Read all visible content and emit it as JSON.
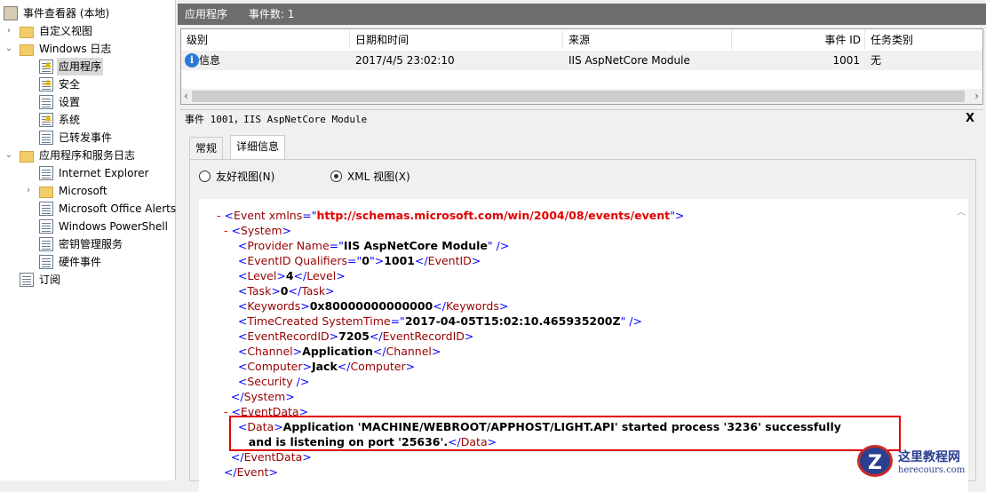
{
  "tree": [
    {
      "label": "事件查看器 (本地)",
      "icon": "root",
      "exp": ""
    },
    {
      "label": "自定义视图",
      "icon": "folder",
      "exp": ">"
    },
    {
      "label": "Windows 日志",
      "icon": "folder",
      "exp": "v"
    },
    {
      "label": "应用程序",
      "icon": "log-warn",
      "exp": "",
      "selected": true
    },
    {
      "label": "安全",
      "icon": "log-warn",
      "exp": ""
    },
    {
      "label": "设置",
      "icon": "log",
      "exp": ""
    },
    {
      "label": "系统",
      "icon": "log-warn",
      "exp": ""
    },
    {
      "label": "已转发事件",
      "icon": "log",
      "exp": ""
    },
    {
      "label": "应用程序和服务日志",
      "icon": "folder",
      "exp": "v"
    },
    {
      "label": "Internet Explorer",
      "icon": "log",
      "exp": ""
    },
    {
      "label": "Microsoft",
      "icon": "folder",
      "exp": ">"
    },
    {
      "label": "Microsoft Office Alerts",
      "icon": "log",
      "exp": ""
    },
    {
      "label": "Windows PowerShell",
      "icon": "log",
      "exp": ""
    },
    {
      "label": "密钥管理服务",
      "icon": "log",
      "exp": ""
    },
    {
      "label": "硬件事件",
      "icon": "log",
      "exp": ""
    },
    {
      "label": "订阅",
      "icon": "log",
      "exp": ""
    }
  ],
  "header": {
    "title": "应用程序",
    "count": "事件数: 1"
  },
  "grid": {
    "columns": [
      "级别",
      "日期和时间",
      "来源",
      "事件 ID",
      "任务类别"
    ],
    "row": {
      "level": "信息",
      "date": "2017/4/5 23:02:10",
      "source": "IIS AspNetCore Module",
      "id": "1001",
      "task": "无"
    }
  },
  "detail": {
    "title": "事件 1001，IIS AspNetCore Module",
    "close": "X",
    "tabs": [
      "常规",
      "详细信息"
    ],
    "radio_friendly": "友好视图(N)",
    "radio_xml": "XML 视图(X)"
  },
  "xml": [
    [
      [
        "m",
        "- "
      ],
      [
        "b",
        "<"
      ],
      [
        "n",
        "Event xmlns"
      ],
      [
        "b",
        "=\""
      ],
      [
        "v",
        "http://schemas.microsoft.com/win/2004/08/events/event"
      ],
      [
        "b",
        "\">"
      ]
    ],
    [
      [
        "m",
        "  - "
      ],
      [
        "b",
        "<"
      ],
      [
        "n",
        "System"
      ],
      [
        "b",
        ">"
      ]
    ],
    [
      [
        "",
        "      "
      ],
      [
        "b",
        "<"
      ],
      [
        "n",
        "Provider Name"
      ],
      [
        "b",
        "=\""
      ],
      [
        "t",
        "IIS AspNetCore Module"
      ],
      [
        "b",
        "\" />"
      ]
    ],
    [
      [
        "",
        "      "
      ],
      [
        "b",
        "<"
      ],
      [
        "n",
        "EventID Qualifiers"
      ],
      [
        "b",
        "=\""
      ],
      [
        "t",
        "0"
      ],
      [
        "b",
        "\">"
      ],
      [
        "t",
        "1001"
      ],
      [
        "b",
        "</"
      ],
      [
        "n",
        "EventID"
      ],
      [
        "b",
        ">"
      ]
    ],
    [
      [
        "",
        "      "
      ],
      [
        "b",
        "<"
      ],
      [
        "n",
        "Level"
      ],
      [
        "b",
        ">"
      ],
      [
        "t",
        "4"
      ],
      [
        "b",
        "</"
      ],
      [
        "n",
        "Level"
      ],
      [
        "b",
        ">"
      ]
    ],
    [
      [
        "",
        "      "
      ],
      [
        "b",
        "<"
      ],
      [
        "n",
        "Task"
      ],
      [
        "b",
        ">"
      ],
      [
        "t",
        "0"
      ],
      [
        "b",
        "</"
      ],
      [
        "n",
        "Task"
      ],
      [
        "b",
        ">"
      ]
    ],
    [
      [
        "",
        "      "
      ],
      [
        "b",
        "<"
      ],
      [
        "n",
        "Keywords"
      ],
      [
        "b",
        ">"
      ],
      [
        "t",
        "0x80000000000000"
      ],
      [
        "b",
        "</"
      ],
      [
        "n",
        "Keywords"
      ],
      [
        "b",
        ">"
      ]
    ],
    [
      [
        "",
        "      "
      ],
      [
        "b",
        "<"
      ],
      [
        "n",
        "TimeCreated SystemTime"
      ],
      [
        "b",
        "=\""
      ],
      [
        "t",
        "2017-04-05T15:02:10.465935200Z"
      ],
      [
        "b",
        "\" />"
      ]
    ],
    [
      [
        "",
        "      "
      ],
      [
        "b",
        "<"
      ],
      [
        "n",
        "EventRecordID"
      ],
      [
        "b",
        ">"
      ],
      [
        "t",
        "7205"
      ],
      [
        "b",
        "</"
      ],
      [
        "n",
        "EventRecordID"
      ],
      [
        "b",
        ">"
      ]
    ],
    [
      [
        "",
        "      "
      ],
      [
        "b",
        "<"
      ],
      [
        "n",
        "Channel"
      ],
      [
        "b",
        ">"
      ],
      [
        "t",
        "Application"
      ],
      [
        "b",
        "</"
      ],
      [
        "n",
        "Channel"
      ],
      [
        "b",
        ">"
      ]
    ],
    [
      [
        "",
        "      "
      ],
      [
        "b",
        "<"
      ],
      [
        "n",
        "Computer"
      ],
      [
        "b",
        ">"
      ],
      [
        "t",
        "Jack"
      ],
      [
        "b",
        "</"
      ],
      [
        "n",
        "Computer"
      ],
      [
        "b",
        ">"
      ]
    ],
    [
      [
        "",
        "      "
      ],
      [
        "b",
        "<"
      ],
      [
        "n",
        "Security"
      ],
      [
        "b",
        " />"
      ]
    ],
    [
      [
        "",
        "    "
      ],
      [
        "b",
        "</"
      ],
      [
        "n",
        "System"
      ],
      [
        "b",
        ">"
      ]
    ],
    [
      [
        "m",
        "  - "
      ],
      [
        "b",
        "<"
      ],
      [
        "n",
        "EventData"
      ],
      [
        "b",
        ">"
      ]
    ],
    [
      [
        "",
        "      "
      ],
      [
        "b",
        "<"
      ],
      [
        "n",
        "Data"
      ],
      [
        "b",
        ">"
      ],
      [
        "t",
        "Application 'MACHINE/WEBROOT/APPHOST/LIGHT.API' started process '3236' successfully"
      ]
    ],
    [
      [
        "",
        "         "
      ],
      [
        "t",
        "and is listening on port '25636'."
      ],
      [
        "b",
        "</"
      ],
      [
        "n",
        "Data"
      ],
      [
        "b",
        ">"
      ]
    ],
    [
      [
        "",
        "    "
      ],
      [
        "b",
        "</"
      ],
      [
        "n",
        "EventData"
      ],
      [
        "b",
        ">"
      ]
    ],
    [
      [
        "",
        "  "
      ],
      [
        "b",
        "</"
      ],
      [
        "n",
        "Event"
      ],
      [
        "b",
        ">"
      ]
    ]
  ],
  "watermark": {
    "cn": "这里教程网",
    "en": "herecours.com"
  }
}
